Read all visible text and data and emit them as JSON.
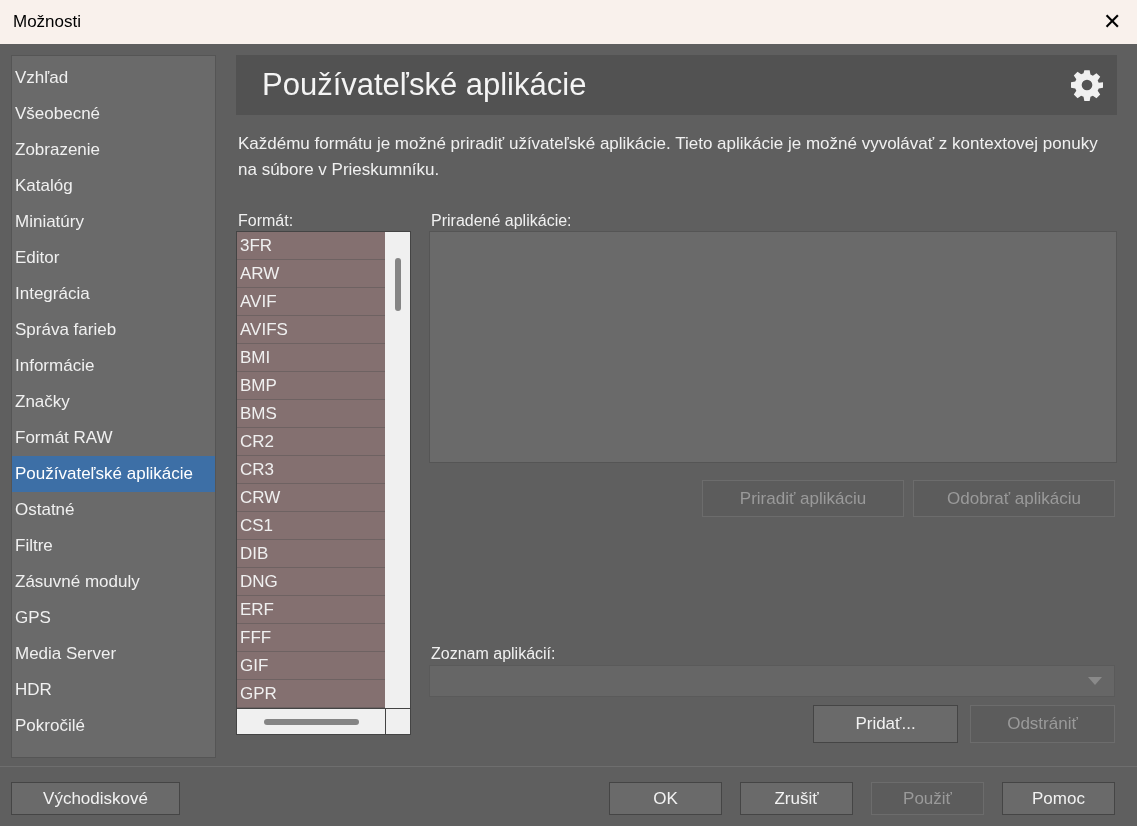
{
  "window": {
    "title": "Možnosti",
    "close": "✕"
  },
  "sidebar": {
    "items": [
      {
        "label": "Vzhľad",
        "selected": false
      },
      {
        "label": "Všeobecné",
        "selected": false
      },
      {
        "label": "Zobrazenie",
        "selected": false
      },
      {
        "label": "Katalóg",
        "selected": false
      },
      {
        "label": "Miniatúry",
        "selected": false
      },
      {
        "label": "Editor",
        "selected": false
      },
      {
        "label": "Integrácia",
        "selected": false
      },
      {
        "label": "Správa farieb",
        "selected": false
      },
      {
        "label": "Informácie",
        "selected": false
      },
      {
        "label": "Značky",
        "selected": false
      },
      {
        "label": "Formát RAW",
        "selected": false
      },
      {
        "label": "Používateľské aplikácie",
        "selected": true
      },
      {
        "label": "Ostatné",
        "selected": false
      },
      {
        "label": "Filtre",
        "selected": false
      },
      {
        "label": "Zásuvné moduly",
        "selected": false
      },
      {
        "label": "GPS",
        "selected": false
      },
      {
        "label": "Media Server",
        "selected": false
      },
      {
        "label": "HDR",
        "selected": false
      },
      {
        "label": "Pokročilé",
        "selected": false
      }
    ]
  },
  "page": {
    "title": "Používateľské aplikácie",
    "description": "Každému formátu je možné priradiť užívateľské aplikácie. Tieto aplikácie je možné vyvolávať z kontextovej ponuky na súbore v Prieskumníku."
  },
  "formats": {
    "label": "Formát:",
    "items": [
      "3FR",
      "ARW",
      "AVIF",
      "AVIFS",
      "BMI",
      "BMP",
      "BMS",
      "CR2",
      "CR3",
      "CRW",
      "CS1",
      "DIB",
      "DNG",
      "ERF",
      "FFF",
      "GIF",
      "GPR"
    ]
  },
  "assigned": {
    "label": "Priradené aplikácie:",
    "buttons": [
      {
        "label": "Priradiť aplikáciu",
        "disabled": true
      },
      {
        "label": "Odobrať aplikáciu",
        "disabled": true
      }
    ]
  },
  "app_list": {
    "label": "Zoznam aplikácií:",
    "buttons": [
      {
        "label": "Pridať...",
        "disabled": false
      },
      {
        "label": "Odstrániť",
        "disabled": true
      }
    ]
  },
  "footer": {
    "defaults": {
      "label": "Východiskové",
      "disabled": false
    },
    "buttons": [
      {
        "label": "OK",
        "disabled": false
      },
      {
        "label": "Zrušiť",
        "disabled": false
      },
      {
        "label": "Použiť",
        "disabled": true
      },
      {
        "label": "Pomoc",
        "disabled": false
      }
    ]
  }
}
